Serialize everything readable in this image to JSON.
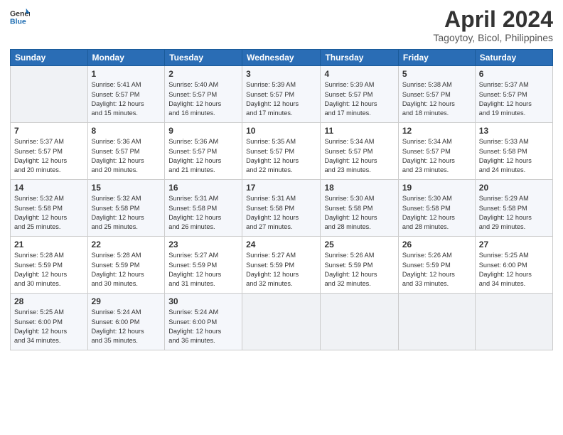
{
  "header": {
    "logo_line1": "General",
    "logo_line2": "Blue",
    "title": "April 2024",
    "subtitle": "Tagoytoy, Bicol, Philippines"
  },
  "calendar": {
    "headers": [
      "Sunday",
      "Monday",
      "Tuesday",
      "Wednesday",
      "Thursday",
      "Friday",
      "Saturday"
    ],
    "rows": [
      [
        {
          "day": "",
          "info": ""
        },
        {
          "day": "1",
          "info": "Sunrise: 5:41 AM\nSunset: 5:57 PM\nDaylight: 12 hours\nand 15 minutes."
        },
        {
          "day": "2",
          "info": "Sunrise: 5:40 AM\nSunset: 5:57 PM\nDaylight: 12 hours\nand 16 minutes."
        },
        {
          "day": "3",
          "info": "Sunrise: 5:39 AM\nSunset: 5:57 PM\nDaylight: 12 hours\nand 17 minutes."
        },
        {
          "day": "4",
          "info": "Sunrise: 5:39 AM\nSunset: 5:57 PM\nDaylight: 12 hours\nand 17 minutes."
        },
        {
          "day": "5",
          "info": "Sunrise: 5:38 AM\nSunset: 5:57 PM\nDaylight: 12 hours\nand 18 minutes."
        },
        {
          "day": "6",
          "info": "Sunrise: 5:37 AM\nSunset: 5:57 PM\nDaylight: 12 hours\nand 19 minutes."
        }
      ],
      [
        {
          "day": "7",
          "info": "Sunrise: 5:37 AM\nSunset: 5:57 PM\nDaylight: 12 hours\nand 20 minutes."
        },
        {
          "day": "8",
          "info": "Sunrise: 5:36 AM\nSunset: 5:57 PM\nDaylight: 12 hours\nand 20 minutes."
        },
        {
          "day": "9",
          "info": "Sunrise: 5:36 AM\nSunset: 5:57 PM\nDaylight: 12 hours\nand 21 minutes."
        },
        {
          "day": "10",
          "info": "Sunrise: 5:35 AM\nSunset: 5:57 PM\nDaylight: 12 hours\nand 22 minutes."
        },
        {
          "day": "11",
          "info": "Sunrise: 5:34 AM\nSunset: 5:57 PM\nDaylight: 12 hours\nand 23 minutes."
        },
        {
          "day": "12",
          "info": "Sunrise: 5:34 AM\nSunset: 5:57 PM\nDaylight: 12 hours\nand 23 minutes."
        },
        {
          "day": "13",
          "info": "Sunrise: 5:33 AM\nSunset: 5:58 PM\nDaylight: 12 hours\nand 24 minutes."
        }
      ],
      [
        {
          "day": "14",
          "info": "Sunrise: 5:32 AM\nSunset: 5:58 PM\nDaylight: 12 hours\nand 25 minutes."
        },
        {
          "day": "15",
          "info": "Sunrise: 5:32 AM\nSunset: 5:58 PM\nDaylight: 12 hours\nand 25 minutes."
        },
        {
          "day": "16",
          "info": "Sunrise: 5:31 AM\nSunset: 5:58 PM\nDaylight: 12 hours\nand 26 minutes."
        },
        {
          "day": "17",
          "info": "Sunrise: 5:31 AM\nSunset: 5:58 PM\nDaylight: 12 hours\nand 27 minutes."
        },
        {
          "day": "18",
          "info": "Sunrise: 5:30 AM\nSunset: 5:58 PM\nDaylight: 12 hours\nand 28 minutes."
        },
        {
          "day": "19",
          "info": "Sunrise: 5:30 AM\nSunset: 5:58 PM\nDaylight: 12 hours\nand 28 minutes."
        },
        {
          "day": "20",
          "info": "Sunrise: 5:29 AM\nSunset: 5:58 PM\nDaylight: 12 hours\nand 29 minutes."
        }
      ],
      [
        {
          "day": "21",
          "info": "Sunrise: 5:28 AM\nSunset: 5:59 PM\nDaylight: 12 hours\nand 30 minutes."
        },
        {
          "day": "22",
          "info": "Sunrise: 5:28 AM\nSunset: 5:59 PM\nDaylight: 12 hours\nand 30 minutes."
        },
        {
          "day": "23",
          "info": "Sunrise: 5:27 AM\nSunset: 5:59 PM\nDaylight: 12 hours\nand 31 minutes."
        },
        {
          "day": "24",
          "info": "Sunrise: 5:27 AM\nSunset: 5:59 PM\nDaylight: 12 hours\nand 32 minutes."
        },
        {
          "day": "25",
          "info": "Sunrise: 5:26 AM\nSunset: 5:59 PM\nDaylight: 12 hours\nand 32 minutes."
        },
        {
          "day": "26",
          "info": "Sunrise: 5:26 AM\nSunset: 5:59 PM\nDaylight: 12 hours\nand 33 minutes."
        },
        {
          "day": "27",
          "info": "Sunrise: 5:25 AM\nSunset: 6:00 PM\nDaylight: 12 hours\nand 34 minutes."
        }
      ],
      [
        {
          "day": "28",
          "info": "Sunrise: 5:25 AM\nSunset: 6:00 PM\nDaylight: 12 hours\nand 34 minutes."
        },
        {
          "day": "29",
          "info": "Sunrise: 5:24 AM\nSunset: 6:00 PM\nDaylight: 12 hours\nand 35 minutes."
        },
        {
          "day": "30",
          "info": "Sunrise: 5:24 AM\nSunset: 6:00 PM\nDaylight: 12 hours\nand 36 minutes."
        },
        {
          "day": "",
          "info": ""
        },
        {
          "day": "",
          "info": ""
        },
        {
          "day": "",
          "info": ""
        },
        {
          "day": "",
          "info": ""
        }
      ]
    ]
  }
}
